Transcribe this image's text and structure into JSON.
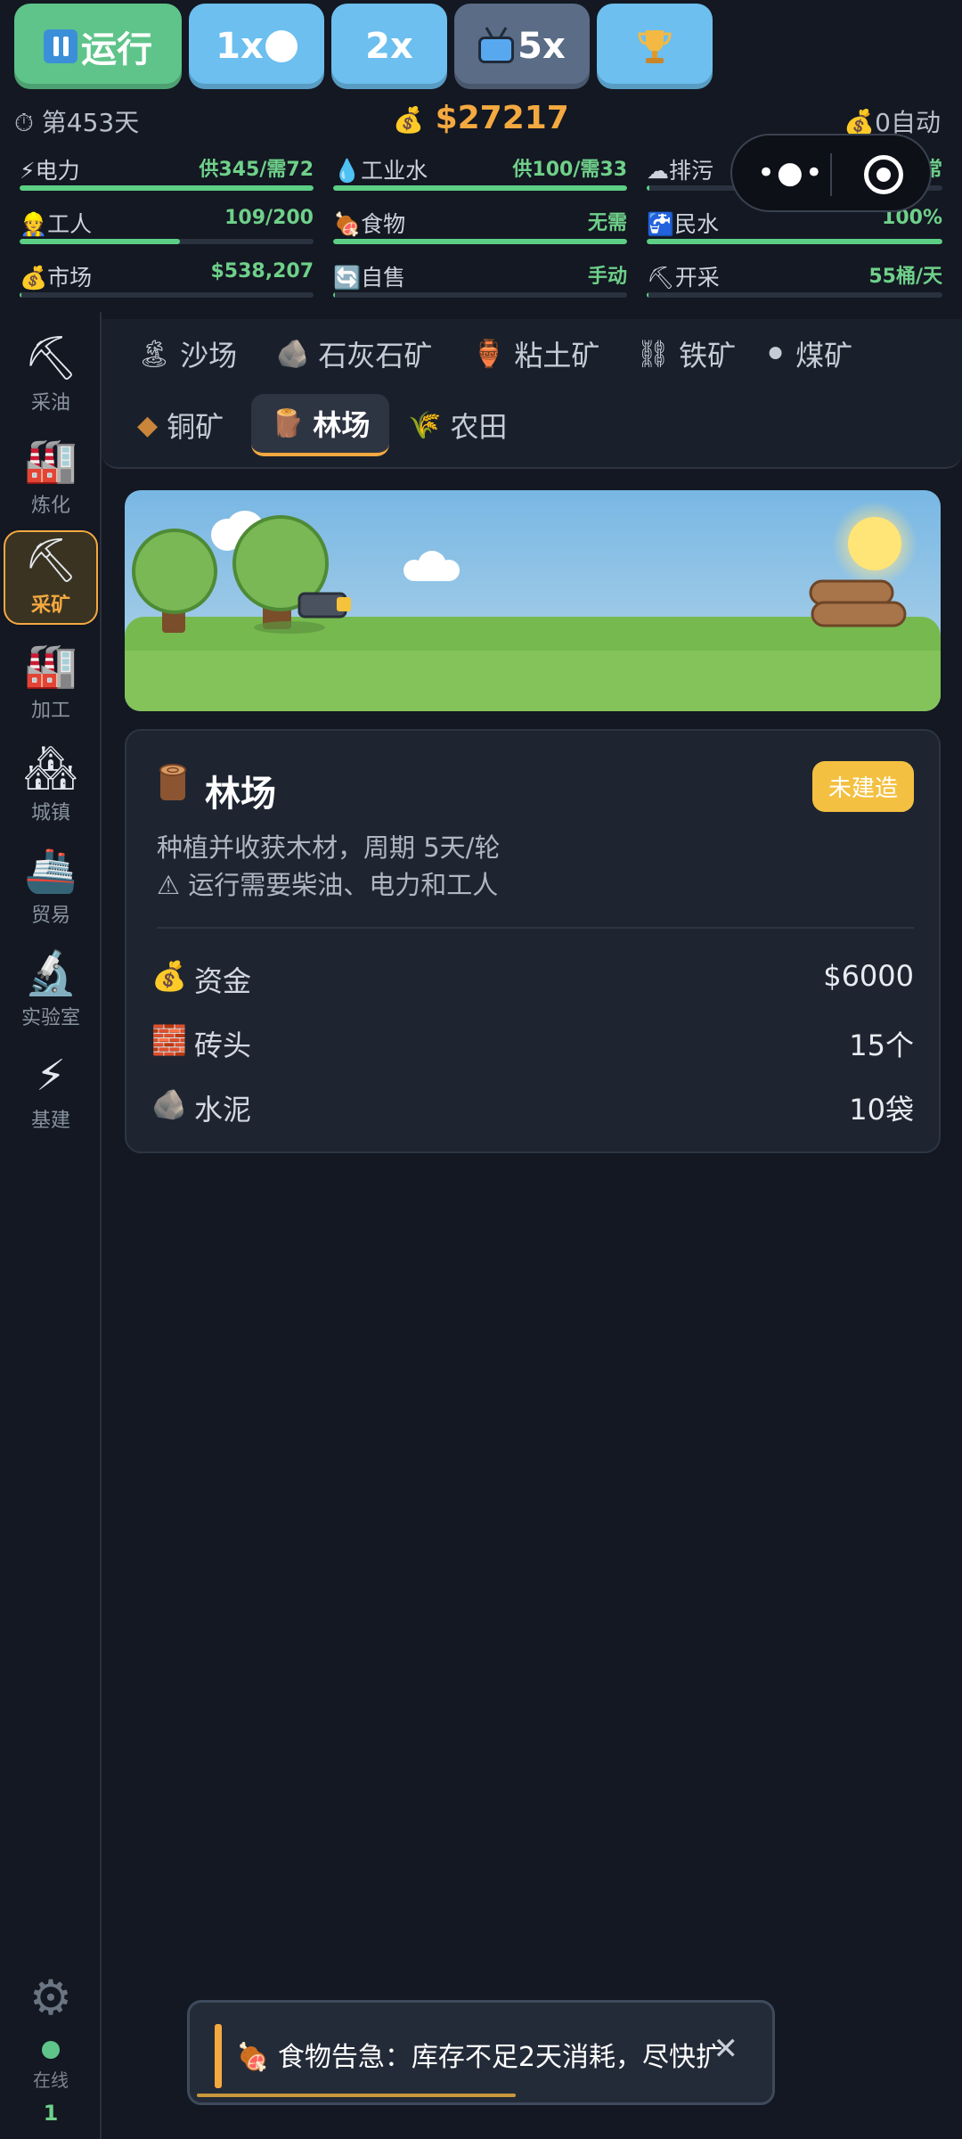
{
  "controls": {
    "run_label": "运行",
    "speed_1x": "1x",
    "speed_2x": "2x",
    "speed_5x": "5x",
    "trophy_icon": "trophy-icon"
  },
  "status": {
    "day": "第453天",
    "money": "$27217",
    "auto": "0自动"
  },
  "stats": [
    {
      "name": "电力",
      "icon": "⚡",
      "value": "供345/需72",
      "bar": 1.0
    },
    {
      "name": "工业水",
      "icon": "💧",
      "value": "供100/需33",
      "bar": 1.0
    },
    {
      "name": "排污",
      "icon": "☁",
      "value": "正常",
      "bar": 0.01
    },
    {
      "name": "工人",
      "icon": "👷",
      "value": "109/200",
      "bar": 0.545
    },
    {
      "name": "食物",
      "icon": "🍖",
      "value": "无需",
      "bar": 1.0
    },
    {
      "name": "民水",
      "icon": "🚰",
      "value": "100%",
      "bar": 1.0
    },
    {
      "name": "市场",
      "icon": "💰",
      "value": "$538,207",
      "bar": 0.005
    },
    {
      "name": "自售",
      "icon": "🔄",
      "value": "手动",
      "bar": 0.005
    },
    {
      "name": "开采",
      "icon": "⛏",
      "value": "55桶/天",
      "bar": 0.005
    }
  ],
  "sidebar": {
    "items": [
      {
        "label": "采油",
        "icon": "⛏"
      },
      {
        "label": "炼化",
        "icon": "🏭"
      },
      {
        "label": "采矿",
        "icon": "⛏"
      },
      {
        "label": "加工",
        "icon": "🏭"
      },
      {
        "label": "城镇",
        "icon": "🏘"
      },
      {
        "label": "贸易",
        "icon": "🚢"
      },
      {
        "label": "实验室",
        "icon": "🔬"
      },
      {
        "label": "基建",
        "icon": "⚡"
      }
    ],
    "online_label": "在线",
    "online_count": "1"
  },
  "tabs": [
    {
      "label": "沙场",
      "icon": "🏝"
    },
    {
      "label": "石灰石矿",
      "icon": "🪨"
    },
    {
      "label": "粘土矿",
      "icon": "🏺"
    },
    {
      "label": "铁矿",
      "icon": "⛓"
    },
    {
      "label": "煤矿",
      "icon": "⚫"
    },
    {
      "label": "铜矿",
      "icon": "◆"
    },
    {
      "label": "林场",
      "icon": "🪵"
    },
    {
      "label": "农田",
      "icon": "🌾"
    }
  ],
  "building": {
    "title": "林场",
    "status": "未建造",
    "desc1": "种植并收获木材，周期 5天/轮",
    "desc2": "⚠ 运行需要柴油、电力和工人",
    "costs": [
      {
        "icon": "💰",
        "name": "资金",
        "value": "$6000"
      },
      {
        "icon": "🧱",
        "name": "砖头",
        "value": "15个"
      },
      {
        "icon": "🪨",
        "name": "水泥",
        "value": "10袋"
      }
    ]
  },
  "toast": {
    "message": "🍖 食物告急：库存不足2天消耗，尽快扩",
    "close": "✕",
    "progress": 0.55
  },
  "colors": {
    "accent": "#f4a940",
    "good": "#6fd08a",
    "badge": "#f4c041"
  }
}
